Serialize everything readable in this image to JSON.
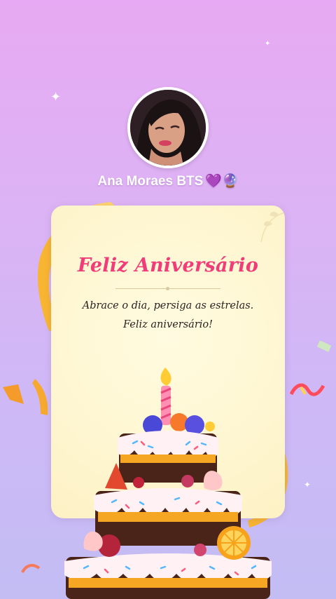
{
  "profile": {
    "name": "Ana Moraes BTS",
    "name_emojis": "💜🔮"
  },
  "card": {
    "title": "Feliz Aniversário",
    "message": "Abrace o dia, persiga as estrelas. Feliz aniversário!"
  },
  "colors": {
    "title": "#f03c78",
    "background_top": "#e7a9f3",
    "background_bottom": "#c3bdf4",
    "card": "#fff8d6"
  },
  "icons": [
    "sparkle-icon",
    "birthday-cake-icon",
    "candle-icon",
    "ribbon-icon"
  ]
}
